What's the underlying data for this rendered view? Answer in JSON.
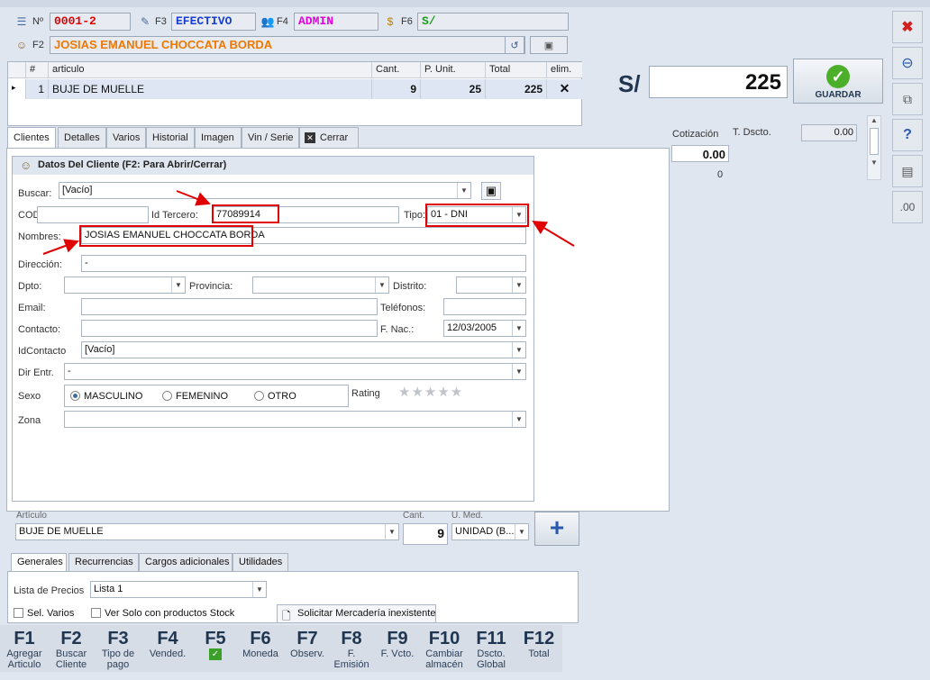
{
  "header": {
    "doc_no_label": "Nº",
    "doc_no": "0001-2",
    "f3_label": "F3",
    "payment": "EFECTIVO",
    "f4_label": "F4",
    "user": "ADMIN",
    "f6_label": "F6",
    "currency": "S/",
    "f2_label": "F2",
    "client_name": "JOSIAS EMANUEL CHOCCATA BORDA"
  },
  "grid": {
    "columns": [
      "#",
      "articulo",
      "Cant.",
      "P. Unit.",
      "Total",
      "elim."
    ],
    "rows": [
      {
        "n": "1",
        "articulo": "BUJE DE MUELLE",
        "cant": "9",
        "punit": "25",
        "total": "225"
      }
    ]
  },
  "total": {
    "currency": "S/",
    "amount": "225",
    "save_label": "GUARDAR"
  },
  "side": {
    "cotizacion_label": "Cotización",
    "cotizacion_value": "0.00",
    "dscto_label": "T. Dscto.",
    "dscto_value": "0.00",
    "zero": "0"
  },
  "tabs": [
    "Clientes",
    "Detalles",
    "Varios",
    "Historial",
    "Imagen",
    "Vin / Serie",
    "Cerrar"
  ],
  "client_form": {
    "title": "Datos Del Cliente (F2: Para Abrir/Cerrar)",
    "buscar_label": "Buscar:",
    "buscar_value": "[Vacío]",
    "cod_label": "COD",
    "cod_value": "",
    "idtercero_label": "Id Tercero:",
    "idtercero_value": "77089914",
    "tipo_label": "Tipo:",
    "tipo_value": "01 - DNI",
    "nombres_label": "Nombres:",
    "nombres_value": "JOSIAS EMANUEL CHOCCATA BORDA",
    "direccion_label": "Dirección:",
    "direccion_value": "-",
    "dpto_label": "Dpto:",
    "provincia_label": "Provincia:",
    "distrito_label": "Distrito:",
    "email_label": "Email:",
    "telefonos_label": "Teléfonos:",
    "contacto_label": "Contacto:",
    "fnac_label": "F. Nac.:",
    "fnac_value": "12/03/2005",
    "idcontacto_label": "IdContacto",
    "idcontacto_value": "[Vacío]",
    "direntr_label": "Dir Entr.",
    "direntr_value": "-",
    "sexo_label": "Sexo",
    "sexo_options": [
      "MASCULINO",
      "FEMENINO",
      "OTRO"
    ],
    "rating_label": "Rating",
    "zona_label": "Zona"
  },
  "article": {
    "articulo_label": "Artículo",
    "articulo_value": "BUJE DE MUELLE",
    "cant_label": "Cant.",
    "cant_value": "9",
    "umed_label": "U. Med.",
    "umed_value": "UNIDAD (B..."
  },
  "bottom_tabs": [
    "Generales",
    "Recurrencias",
    "Cargos adicionales",
    "Utilidades"
  ],
  "generales": {
    "lista_label": "Lista de Precios",
    "lista_value": "Lista 1",
    "sel_varios": "Sel. Varios",
    "ver_solo": "Ver Solo con productos Stock",
    "solicitar": "Solicitar Mercadería inexistente"
  },
  "fkeys": [
    {
      "k": "F1",
      "t": "Agregar Articulo"
    },
    {
      "k": "F2",
      "t": "Buscar Cliente"
    },
    {
      "k": "F3",
      "t": "Tipo de pago"
    },
    {
      "k": "F4",
      "t": "Vended."
    },
    {
      "k": "F5",
      "t": ""
    },
    {
      "k": "F6",
      "t": "Moneda"
    },
    {
      "k": "F7",
      "t": "Observ."
    },
    {
      "k": "F8",
      "t": "F. Emisión"
    },
    {
      "k": "F9",
      "t": "F. Vcto."
    },
    {
      "k": "F10",
      "t": "Cambiar almacén"
    },
    {
      "k": "F11",
      "t": "Dscto. Global"
    },
    {
      "k": "F12",
      "t": "Total"
    }
  ],
  "colors": {
    "red": "#e00000",
    "orange": "#f07800",
    "blue": "#1a3fd0",
    "magenta": "#e000e0",
    "green": "#1aa01a"
  }
}
